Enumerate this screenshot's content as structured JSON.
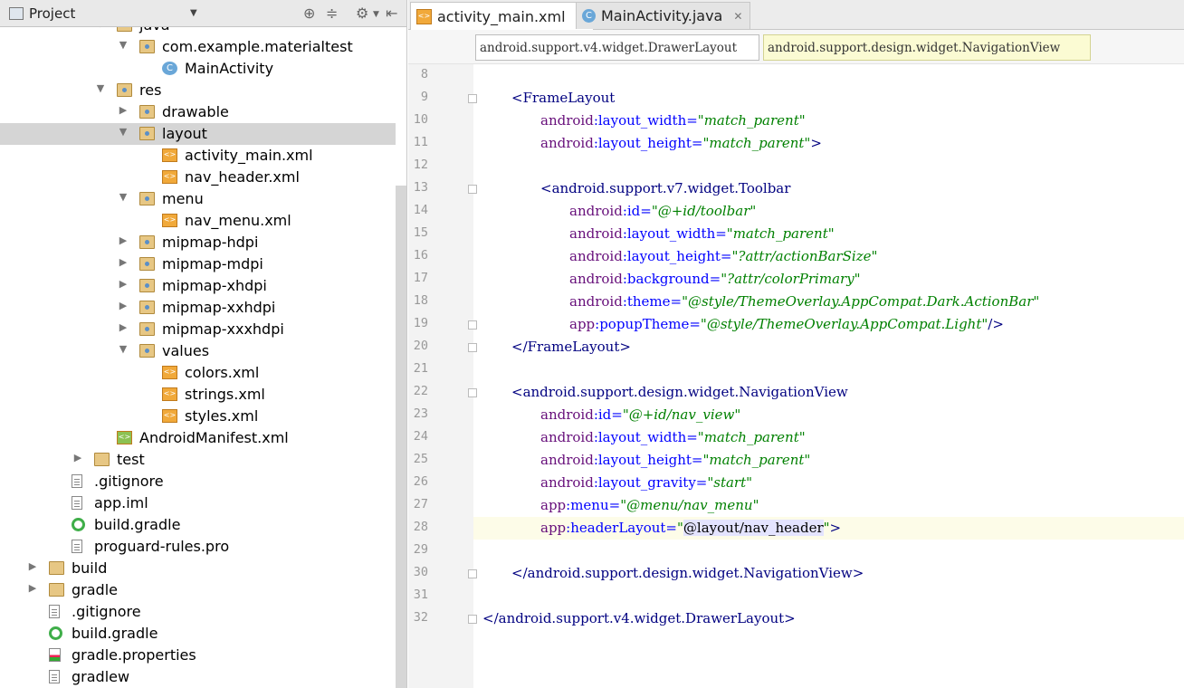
{
  "project_panel": {
    "title": "Project",
    "tree": [
      {
        "label": "java",
        "depth": 5,
        "arrow": "expanded",
        "icon": "folder"
      },
      {
        "label": "com.example.materialtest",
        "depth": 6,
        "arrow": "expanded",
        "icon": "package"
      },
      {
        "label": "MainActivity",
        "depth": 7,
        "arrow": "none",
        "icon": "class"
      },
      {
        "label": "res",
        "depth": 5,
        "arrow": "expanded",
        "icon": "res-folder"
      },
      {
        "label": "drawable",
        "depth": 6,
        "arrow": "collapsed",
        "icon": "folder"
      },
      {
        "label": "layout",
        "depth": 6,
        "arrow": "expanded",
        "icon": "folder",
        "selected": true
      },
      {
        "label": "activity_main.xml",
        "depth": 7,
        "arrow": "none",
        "icon": "xml"
      },
      {
        "label": "nav_header.xml",
        "depth": 7,
        "arrow": "none",
        "icon": "xml"
      },
      {
        "label": "menu",
        "depth": 6,
        "arrow": "expanded",
        "icon": "folder"
      },
      {
        "label": "nav_menu.xml",
        "depth": 7,
        "arrow": "none",
        "icon": "xml"
      },
      {
        "label": "mipmap-hdpi",
        "depth": 6,
        "arrow": "collapsed",
        "icon": "folder"
      },
      {
        "label": "mipmap-mdpi",
        "depth": 6,
        "arrow": "collapsed",
        "icon": "folder"
      },
      {
        "label": "mipmap-xhdpi",
        "depth": 6,
        "arrow": "collapsed",
        "icon": "folder"
      },
      {
        "label": "mipmap-xxhdpi",
        "depth": 6,
        "arrow": "collapsed",
        "icon": "folder"
      },
      {
        "label": "mipmap-xxxhdpi",
        "depth": 6,
        "arrow": "collapsed",
        "icon": "folder"
      },
      {
        "label": "values",
        "depth": 6,
        "arrow": "expanded",
        "icon": "folder"
      },
      {
        "label": "colors.xml",
        "depth": 7,
        "arrow": "none",
        "icon": "xml"
      },
      {
        "label": "strings.xml",
        "depth": 7,
        "arrow": "none",
        "icon": "xml"
      },
      {
        "label": "styles.xml",
        "depth": 7,
        "arrow": "none",
        "icon": "xml"
      },
      {
        "label": "AndroidManifest.xml",
        "depth": 5,
        "arrow": "none",
        "icon": "manifest"
      },
      {
        "label": "test",
        "depth": 4,
        "arrow": "collapsed",
        "icon": "folder-plain"
      },
      {
        "label": ".gitignore",
        "depth": 3,
        "arrow": "none",
        "icon": "file"
      },
      {
        "label": "app.iml",
        "depth": 3,
        "arrow": "none",
        "icon": "file"
      },
      {
        "label": "build.gradle",
        "depth": 3,
        "arrow": "none",
        "icon": "gradle"
      },
      {
        "label": "proguard-rules.pro",
        "depth": 3,
        "arrow": "none",
        "icon": "file"
      },
      {
        "label": "build",
        "depth": 2,
        "arrow": "collapsed",
        "icon": "folder-plain"
      },
      {
        "label": "gradle",
        "depth": 2,
        "arrow": "collapsed",
        "icon": "folder-plain"
      },
      {
        "label": ".gitignore",
        "depth": 2,
        "arrow": "none",
        "icon": "file"
      },
      {
        "label": "build.gradle",
        "depth": 2,
        "arrow": "none",
        "icon": "gradle"
      },
      {
        "label": "gradle.properties",
        "depth": 2,
        "arrow": "none",
        "icon": "properties"
      },
      {
        "label": "gradlew",
        "depth": 2,
        "arrow": "none",
        "icon": "file"
      }
    ]
  },
  "tabs": [
    {
      "label": "activity_main.xml",
      "icon": "xml-file-icon",
      "active": true
    },
    {
      "label": "MainActivity.java",
      "icon": "java-class-icon",
      "active": false
    }
  ],
  "breadcrumbs": [
    "android.support.v4.widget.DrawerLayout",
    "android.support.design.widget.NavigationView"
  ],
  "current_line": 28,
  "code_lines": [
    {
      "n": 8,
      "indent": 0,
      "tokens": []
    },
    {
      "n": 9,
      "indent": 1,
      "fold": true,
      "tokens": [
        [
          "tg",
          "<FrameLayout"
        ]
      ]
    },
    {
      "n": 10,
      "indent": 2,
      "tokens": [
        [
          "ns",
          "android"
        ],
        [
          "at",
          ":layout_width="
        ],
        [
          "vl",
          "\"match_parent\""
        ]
      ]
    },
    {
      "n": 11,
      "indent": 2,
      "tokens": [
        [
          "ns",
          "android"
        ],
        [
          "at",
          ":layout_height="
        ],
        [
          "vl",
          "\"match_parent\""
        ],
        [
          "tg",
          ">"
        ]
      ]
    },
    {
      "n": 12,
      "indent": 0,
      "tokens": []
    },
    {
      "n": 13,
      "indent": 2,
      "fold": true,
      "tokens": [
        [
          "tg",
          "<android.support.v7.widget.Toolbar"
        ]
      ]
    },
    {
      "n": 14,
      "indent": 3,
      "tokens": [
        [
          "ns",
          "android"
        ],
        [
          "at",
          ":id="
        ],
        [
          "vl",
          "\"@+id/toolbar\""
        ]
      ]
    },
    {
      "n": 15,
      "indent": 3,
      "tokens": [
        [
          "ns",
          "android"
        ],
        [
          "at",
          ":layout_width="
        ],
        [
          "vl",
          "\"match_parent\""
        ]
      ]
    },
    {
      "n": 16,
      "indent": 3,
      "tokens": [
        [
          "ns",
          "android"
        ],
        [
          "at",
          ":layout_height="
        ],
        [
          "vl",
          "\"?attr/actionBarSize\""
        ]
      ]
    },
    {
      "n": 17,
      "indent": 3,
      "tokens": [
        [
          "ns",
          "android"
        ],
        [
          "at",
          ":background="
        ],
        [
          "vl",
          "\"?attr/colorPrimary\""
        ]
      ]
    },
    {
      "n": 18,
      "indent": 3,
      "tokens": [
        [
          "ns",
          "android"
        ],
        [
          "at",
          ":theme="
        ],
        [
          "vl",
          "\"@style/ThemeOverlay.AppCompat.Dark.ActionBar\""
        ]
      ]
    },
    {
      "n": 19,
      "indent": 3,
      "fold": true,
      "tokens": [
        [
          "ns",
          "app"
        ],
        [
          "at",
          ":popupTheme="
        ],
        [
          "vl",
          "\"@style/ThemeOverlay.AppCompat.Light\""
        ],
        [
          "tg",
          "/>"
        ]
      ]
    },
    {
      "n": 20,
      "indent": 1,
      "fold": true,
      "tokens": [
        [
          "tg",
          "</FrameLayout>"
        ]
      ]
    },
    {
      "n": 21,
      "indent": 0,
      "tokens": []
    },
    {
      "n": 22,
      "indent": 1,
      "fold": true,
      "tokens": [
        [
          "tg",
          "<android.support.design.widget.NavigationView"
        ]
      ]
    },
    {
      "n": 23,
      "indent": 2,
      "tokens": [
        [
          "ns",
          "android"
        ],
        [
          "at",
          ":id="
        ],
        [
          "vl",
          "\"@+id/nav_view\""
        ]
      ]
    },
    {
      "n": 24,
      "indent": 2,
      "tokens": [
        [
          "ns",
          "android"
        ],
        [
          "at",
          ":layout_width="
        ],
        [
          "vl",
          "\"match_parent\""
        ]
      ]
    },
    {
      "n": 25,
      "indent": 2,
      "tokens": [
        [
          "ns",
          "android"
        ],
        [
          "at",
          ":layout_height="
        ],
        [
          "vl",
          "\"match_parent\""
        ]
      ]
    },
    {
      "n": 26,
      "indent": 2,
      "tokens": [
        [
          "ns",
          "android"
        ],
        [
          "at",
          ":layout_gravity="
        ],
        [
          "vl",
          "\"start\""
        ]
      ]
    },
    {
      "n": 27,
      "indent": 2,
      "tokens": [
        [
          "ns",
          "app"
        ],
        [
          "at",
          ":menu="
        ],
        [
          "vl",
          "\"@menu/nav_menu\""
        ]
      ]
    },
    {
      "n": 28,
      "indent": 2,
      "tokens": [
        [
          "ns",
          "app"
        ],
        [
          "at",
          ":headerLayout="
        ],
        [
          "vl",
          "\""
        ],
        [
          "hl",
          "@layout/nav_header"
        ],
        [
          "vl",
          "\""
        ],
        [
          "tg",
          ">"
        ]
      ]
    },
    {
      "n": 29,
      "indent": 0,
      "tokens": []
    },
    {
      "n": 30,
      "indent": 1,
      "fold": true,
      "tokens": [
        [
          "tg",
          "</android.support.design.widget.NavigationView>"
        ]
      ]
    },
    {
      "n": 31,
      "indent": 0,
      "tokens": []
    },
    {
      "n": 32,
      "indent": 0,
      "fold": true,
      "tokens": [
        [
          "tg",
          "</android.support.v4.widget.DrawerLayout>"
        ]
      ]
    }
  ]
}
